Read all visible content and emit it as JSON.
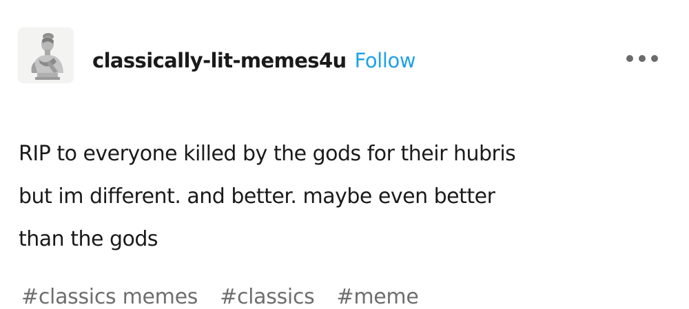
{
  "post": {
    "header": {
      "avatar_icon": "classical-bust-statue-icon",
      "username": "classically-lit-memes4u",
      "follow_label": "Follow",
      "follow_color": "#1ea1e8",
      "more_icon": "more-options-ellipsis-icon"
    },
    "body": {
      "lines": [
        "RIP to everyone killed by the gods for their hubris",
        "but im different. and better. maybe even better",
        "than the gods"
      ]
    },
    "tags": [
      "#classics memes",
      "#classics",
      "#meme"
    ]
  }
}
